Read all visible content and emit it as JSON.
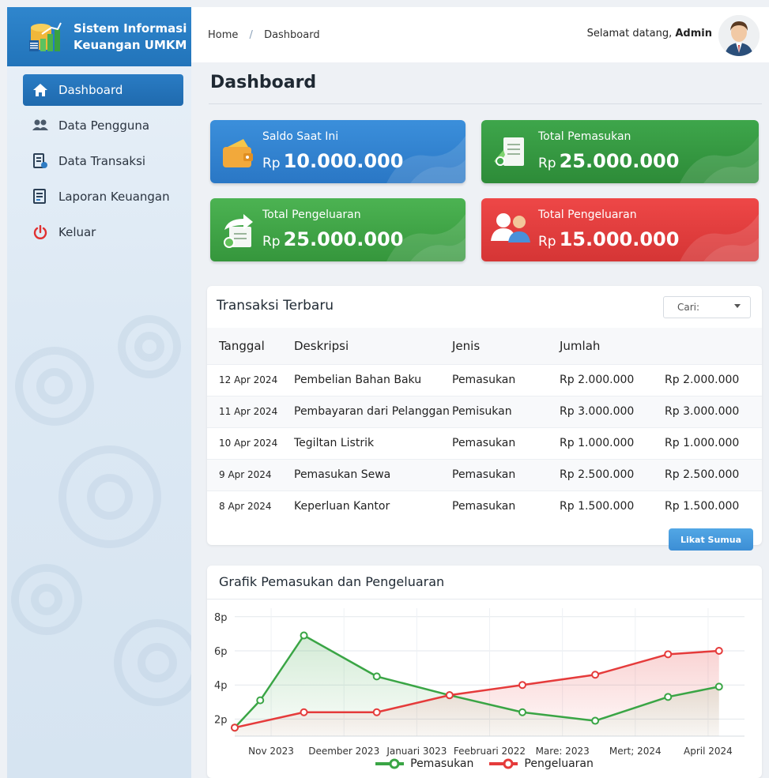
{
  "brand": {
    "line1": "Sistem Informasi",
    "line2": "Keuangan UMKM",
    "icon": "finance-chart-icon"
  },
  "nav": [
    {
      "label": "Dashboard",
      "icon": "home-icon",
      "active": true
    },
    {
      "label": "Data Pengguna",
      "icon": "users-icon"
    },
    {
      "label": "Data Transaksi",
      "icon": "transaction-icon"
    },
    {
      "label": "Laporan Keuangan",
      "icon": "report-icon"
    },
    {
      "label": "Keluar",
      "icon": "power-icon"
    }
  ],
  "breadcrumb": {
    "home": "Home",
    "sep": "/",
    "current": "Dashboard"
  },
  "welcome": {
    "text": "Selamat datang,",
    "user": "Admin"
  },
  "page_title": "Dashboard",
  "cards": [
    {
      "label": "Saldo Saat Ini",
      "currency": "Rp",
      "amount": "10.000.000",
      "color": "#3383d0",
      "icon": "wallet-icon"
    },
    {
      "label": "Total Pemasukan",
      "currency": "Rp",
      "amount": "25.000.000",
      "color": "#359a42",
      "icon": "income-document-icon"
    },
    {
      "label": "Total Pengeluaran",
      "currency": "Rp",
      "amount": "25.000.000",
      "color": "#3fa548",
      "icon": "expense-document-icon"
    },
    {
      "label": "Total Pengeluaran",
      "currency": "Rp",
      "amount": "15.000.000",
      "color": "#e23f3f",
      "icon": "people-icon"
    }
  ],
  "transactions": {
    "title": "Transaksi Terbaru",
    "search_label": "Cari:",
    "columns": [
      "Tanggal",
      "Deskripsi",
      "Jenis",
      "Jumlah",
      ""
    ],
    "rows": [
      [
        "12 Apr 2024",
        "Pembelian Bahan Baku",
        "Pemasukan",
        "Rp 2.000.000",
        "Rp 2.000.000"
      ],
      [
        "11 Apr 2024",
        "Pembayaran dari Pelanggan",
        "Pemisukan",
        "Rp 3.000.000",
        "Rp 3.000.000"
      ],
      [
        "10 Apr 2024",
        "Tegiltan Listrik",
        "Pemasukan",
        "Rp 1.000.000",
        "Rp 1.000.000"
      ],
      [
        "9 Apr 2024",
        "Pemasukan Sewa",
        "Pemasukan",
        "Rp 2.500.000",
        "Rp 2.500.000"
      ],
      [
        "8 Apr 2024",
        "Keperluan Kantor",
        "Pemasukan",
        "Rp 1.500.000",
        "Rp 1.500.000"
      ]
    ],
    "button_label": "Likat Sumua"
  },
  "chart_data": {
    "type": "line",
    "title": "Grafik Pemasukan dan Pengeluaran",
    "categories": [
      "Nov 2023",
      "Deember 2023",
      "Januari 3023",
      "Feebruari 2022",
      "Mare: 2023",
      "Mert; 2024",
      "April 2024"
    ],
    "x_tick_positions": [
      0.5,
      1.5,
      2.5,
      3.5,
      4.5,
      5.5,
      6.5
    ],
    "yticks": [
      "2p",
      "4p",
      "6p",
      "8p"
    ],
    "ytick_values": [
      2,
      4,
      6,
      8
    ],
    "ylim": [
      1,
      8.5
    ],
    "xlim": [
      0,
      7
    ],
    "grid": true,
    "legend": "bottom",
    "series": [
      {
        "name": "Pemasukan",
        "color": "#3aa545",
        "points": [
          [
            0,
            1.5
          ],
          [
            0.35,
            3.1
          ],
          [
            0.95,
            6.9
          ],
          [
            1.95,
            4.5
          ],
          [
            2.95,
            3.4
          ],
          [
            3.95,
            2.4
          ],
          [
            4.95,
            1.9
          ],
          [
            5.95,
            3.3
          ],
          [
            6.65,
            3.9
          ]
        ]
      },
      {
        "name": "Pengeluaran",
        "color": "#e53b3b",
        "points": [
          [
            0,
            1.5
          ],
          [
            0.95,
            2.4
          ],
          [
            1.95,
            2.4
          ],
          [
            2.95,
            3.4
          ],
          [
            3.95,
            4.0
          ],
          [
            4.95,
            4.6
          ],
          [
            5.95,
            5.8
          ],
          [
            6.65,
            6.0
          ]
        ]
      }
    ]
  }
}
